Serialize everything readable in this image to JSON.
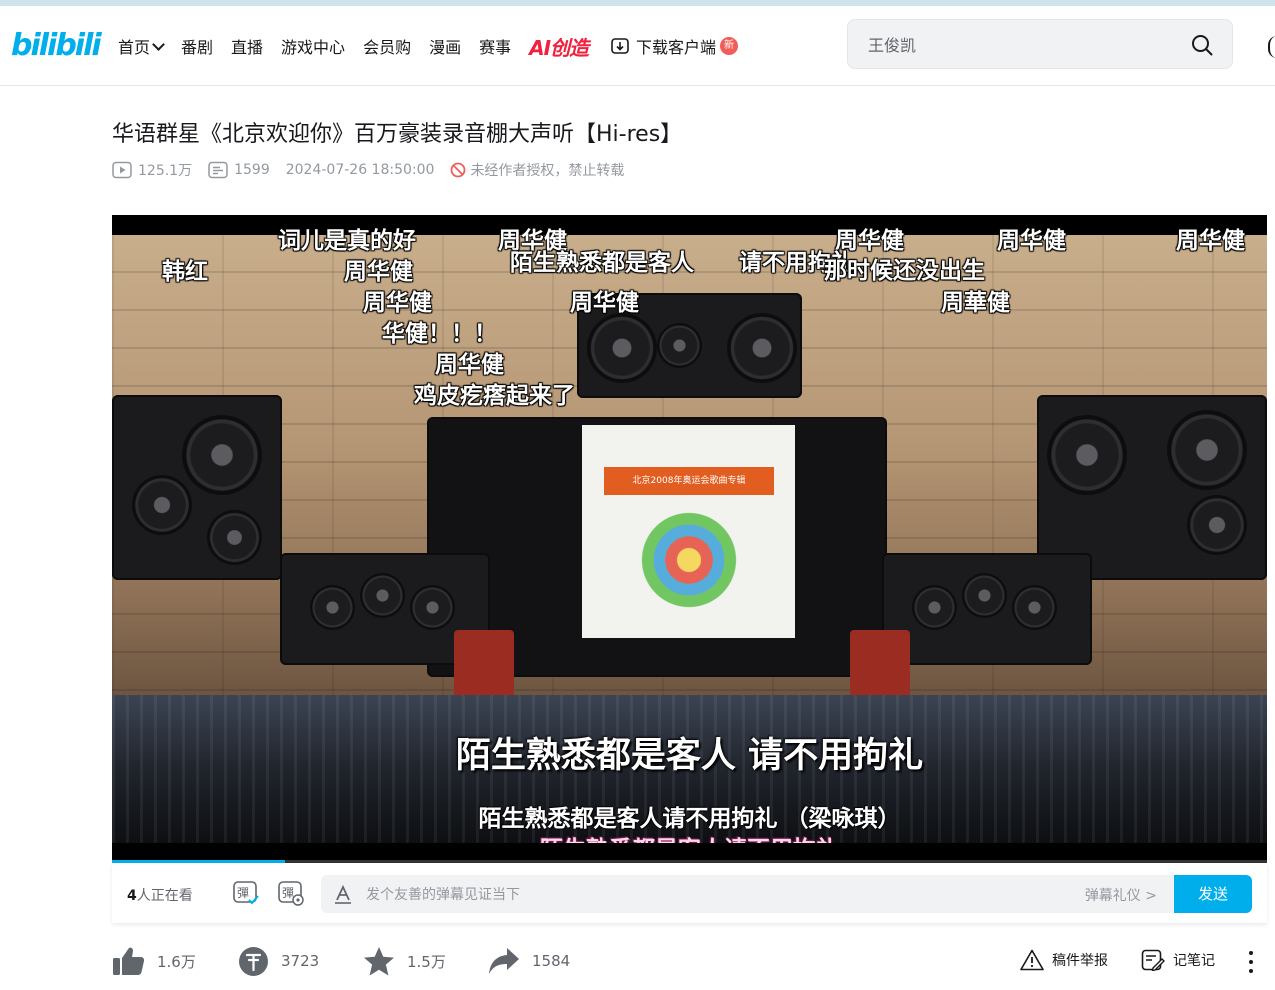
{
  "header": {
    "logo": "bilibili",
    "nav": [
      {
        "label": "首页",
        "dropdown": true
      },
      {
        "label": "番剧"
      },
      {
        "label": "直播"
      },
      {
        "label": "游戏中心"
      },
      {
        "label": "会员购"
      },
      {
        "label": "漫画"
      },
      {
        "label": "赛事"
      }
    ],
    "ai_label": "AI创造",
    "download_label": "下载客户端",
    "new_badge": "新",
    "search_placeholder": "王俊凯"
  },
  "video": {
    "title": "华语群星《北京欢迎你》百万豪装录音棚大声听【Hi-res】",
    "views": "125.1万",
    "danmaku_count": "1599",
    "publish_time": "2024-07-26 18:50:00",
    "copyright_notice": "未经作者授权，禁止转载"
  },
  "player": {
    "progress": 0.15,
    "danmaku": [
      "词儿是真的好",
      "周华健",
      "周华健",
      "周华健",
      "周华健",
      "韩红",
      "周华健",
      "陌生熟悉都是客人",
      "请不用拘礼",
      "那时候还没出生",
      "周华健",
      "周华健",
      "周華健",
      "华健！！！",
      "周华健",
      "鸡皮疙瘩起来了"
    ],
    "subtitle_main": "陌生熟悉都是客人 请不用拘礼",
    "subtitle_secondary": "陌生熟悉都是客人请不用拘礼 （梁咏琪）",
    "subtitle_tertiary": "陌生熟悉都是客人请不用拘礼",
    "screen_text": "北京2008年奥运会歌曲专辑"
  },
  "danmaku_bar": {
    "watching_count": "4",
    "watching_suffix": "人正在看",
    "input_placeholder": "发个友善的弹幕见证当下",
    "etiquette_label": "弹幕礼仪 >",
    "send_label": "发送"
  },
  "actions": {
    "like": "1.6万",
    "coin": "3723",
    "favorite": "1.5万",
    "share": "1584",
    "report": "稿件举报",
    "notes": "记笔记"
  },
  "colors": {
    "brand": "#00aeec",
    "ai": "#f3203d",
    "badge": "#f25d59"
  }
}
